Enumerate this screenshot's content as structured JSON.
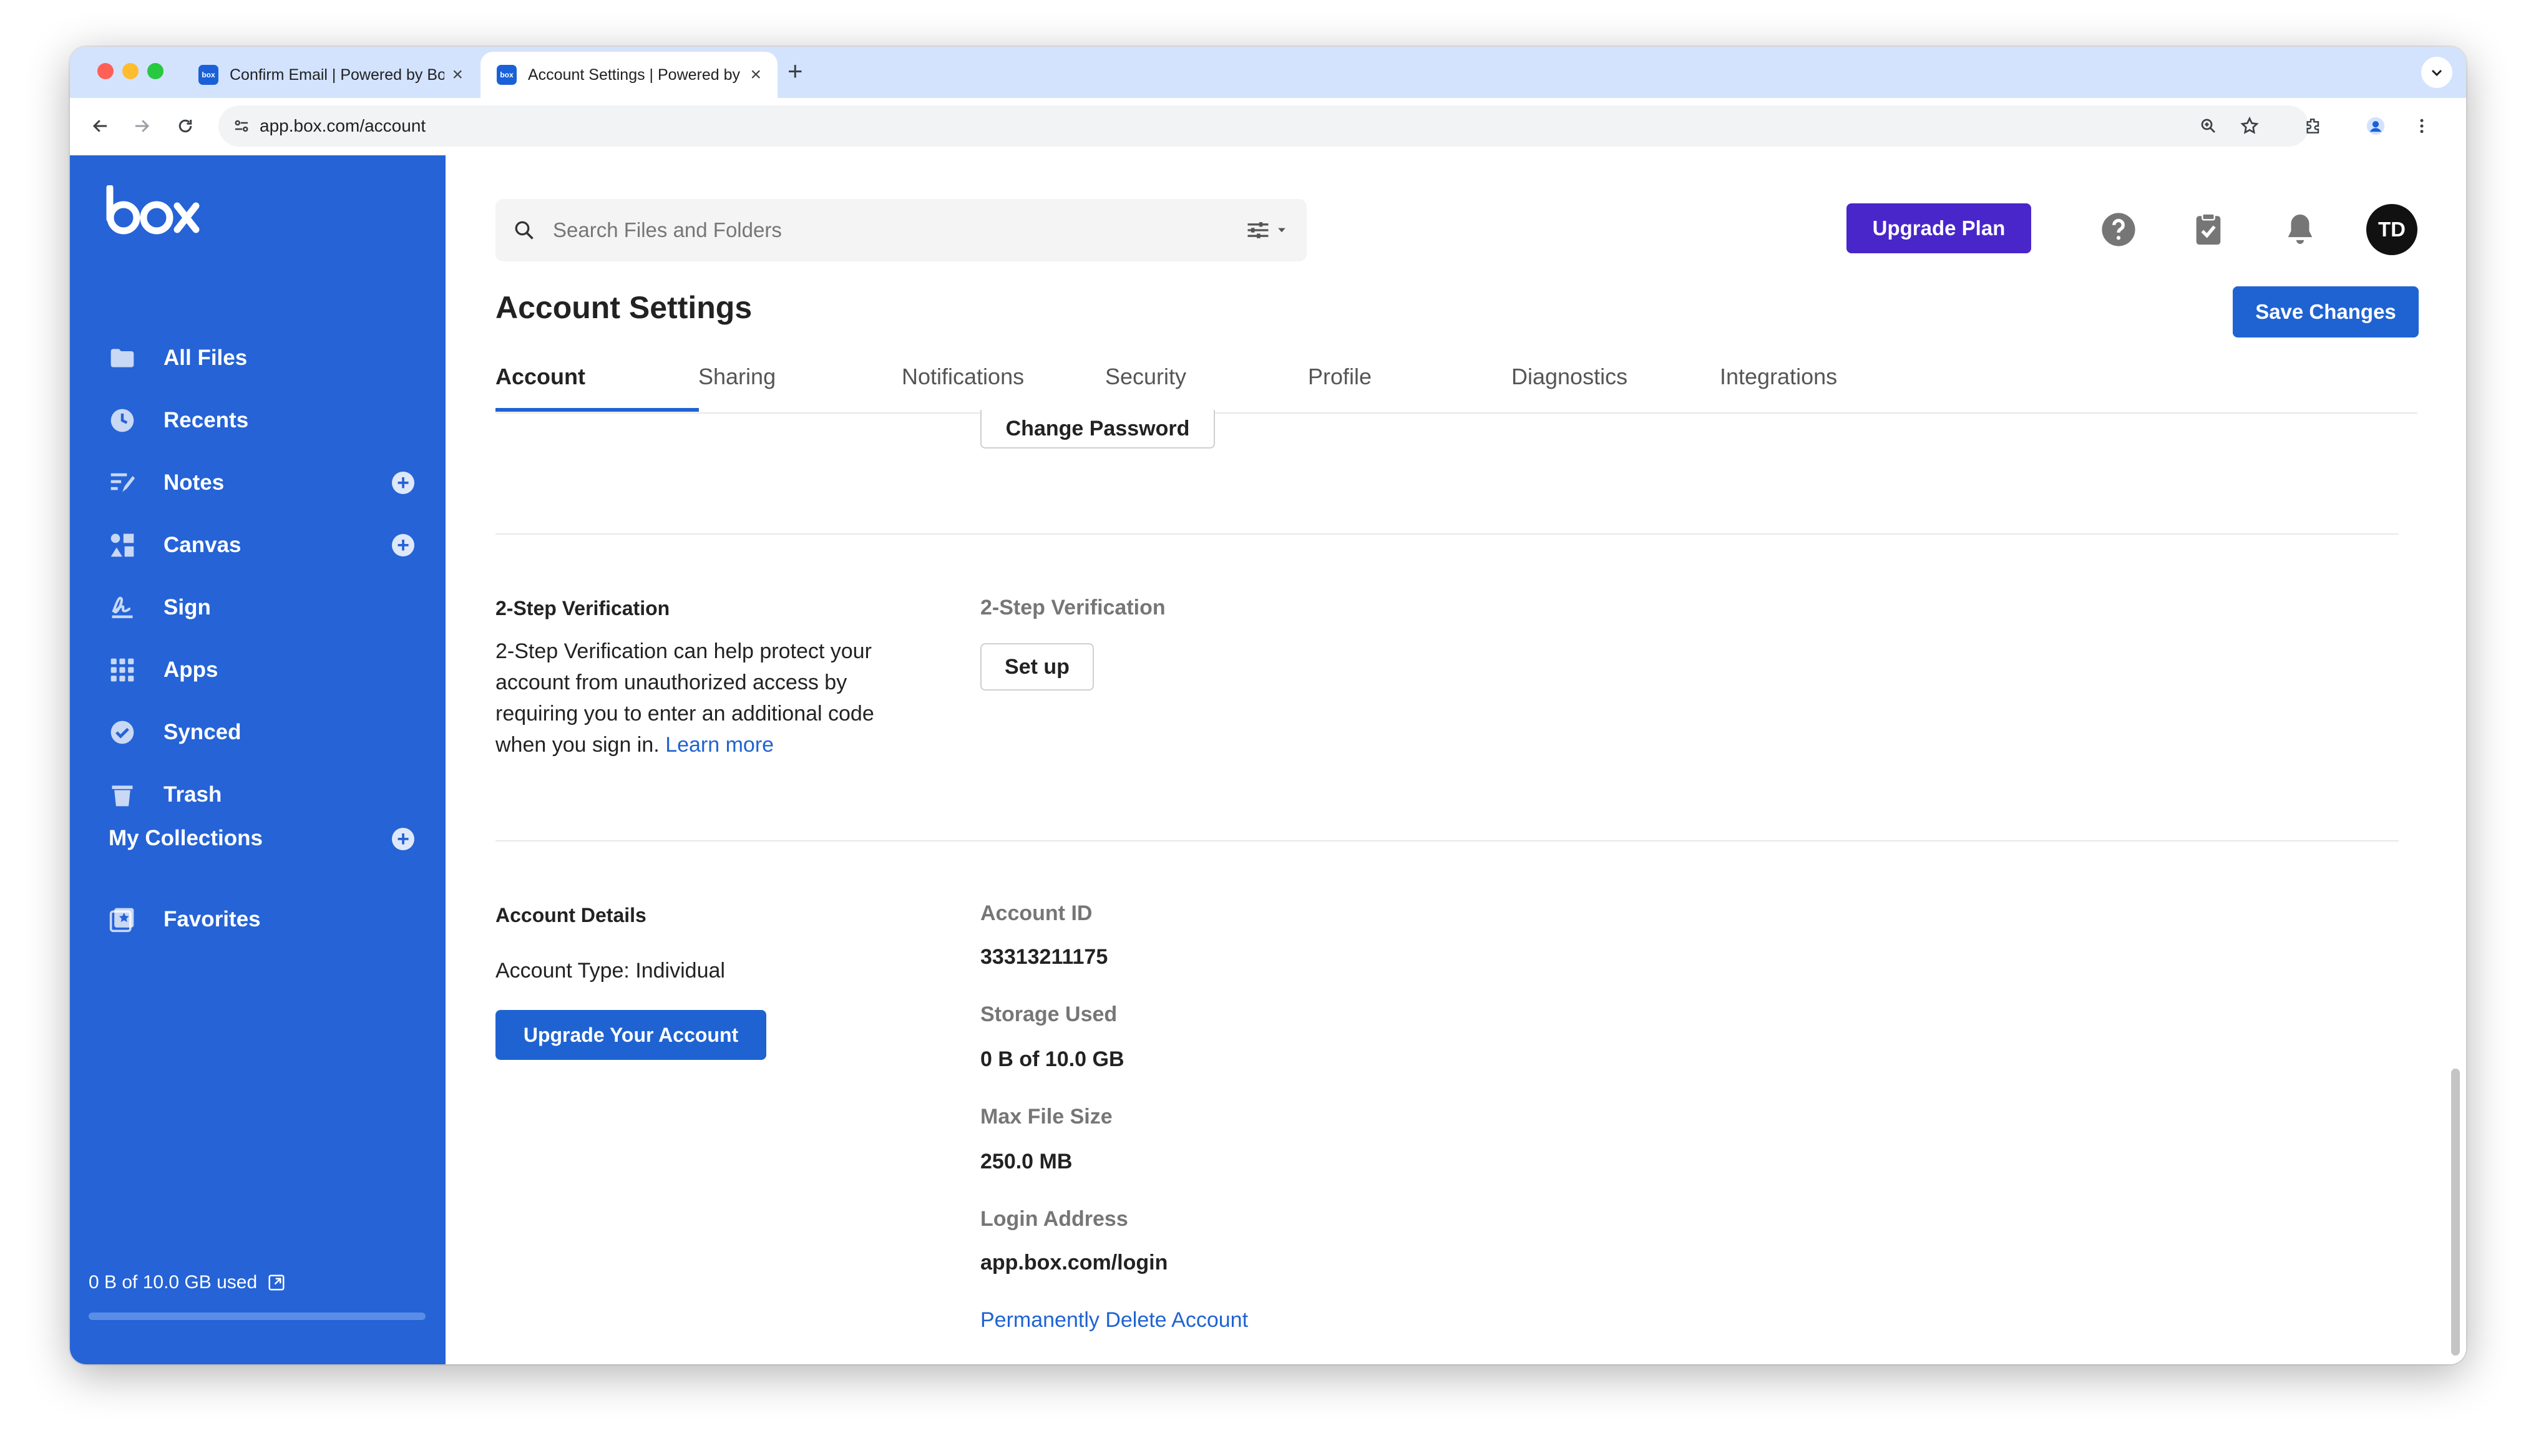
{
  "browser": {
    "tabs": [
      {
        "title": "Confirm Email | Powered by Box",
        "favicon": "box"
      },
      {
        "title": "Account Settings | Powered by Box",
        "favicon": "box"
      }
    ],
    "url": "app.box.com/account"
  },
  "sidebar": {
    "logo": "box",
    "items": [
      {
        "label": "All Files",
        "icon": "folder-icon"
      },
      {
        "label": "Recents",
        "icon": "clock-icon"
      },
      {
        "label": "Notes",
        "icon": "notes-icon"
      },
      {
        "label": "Canvas",
        "icon": "canvas-icon"
      },
      {
        "label": "Sign",
        "icon": "sign-icon"
      },
      {
        "label": "Apps",
        "icon": "apps-grid-icon"
      },
      {
        "label": "Synced",
        "icon": "check-circle-icon"
      },
      {
        "label": "Trash",
        "icon": "trash-icon"
      }
    ],
    "collections_label": "My Collections",
    "collections": [
      {
        "label": "Favorites",
        "icon": "star-collection-icon"
      }
    ],
    "storage_text": "0 B of 10.0 GB used",
    "storage_fraction": 0.0
  },
  "header": {
    "search_placeholder": "Search Files and Folders",
    "upgrade_plan": "Upgrade Plan",
    "avatar_initials": "TD"
  },
  "page": {
    "title": "Account Settings",
    "save_label": "Save Changes",
    "tabs": [
      "Account",
      "Sharing",
      "Notifications",
      "Security",
      "Profile",
      "Diagnostics",
      "Integrations"
    ],
    "active_tab": "Account"
  },
  "password": {
    "change_label": "Change Password"
  },
  "two_step": {
    "title": "2-Step Verification",
    "description": "2-Step Verification can help protect your account from unauthorized access by requiring you to enter an additional code when you sign in.",
    "learn_more": "Learn more",
    "field_label": "2-Step Verification",
    "setup_label": "Set up"
  },
  "account_details": {
    "title": "Account Details",
    "account_type": "Account Type: Individual",
    "upgrade_label": "Upgrade Your Account",
    "fields": [
      {
        "label": "Account ID",
        "value": "33313211175"
      },
      {
        "label": "Storage Used",
        "value": "0 B of 10.0 GB"
      },
      {
        "label": "Max File Size",
        "value": "250.0 MB"
      },
      {
        "label": "Login Address",
        "value": "app.box.com/login"
      }
    ],
    "delete_label": "Permanently Delete Account"
  },
  "colors": {
    "sidebar": "#2563d6",
    "primary": "#1f63d2",
    "upgrade_plan": "#4826c9"
  }
}
